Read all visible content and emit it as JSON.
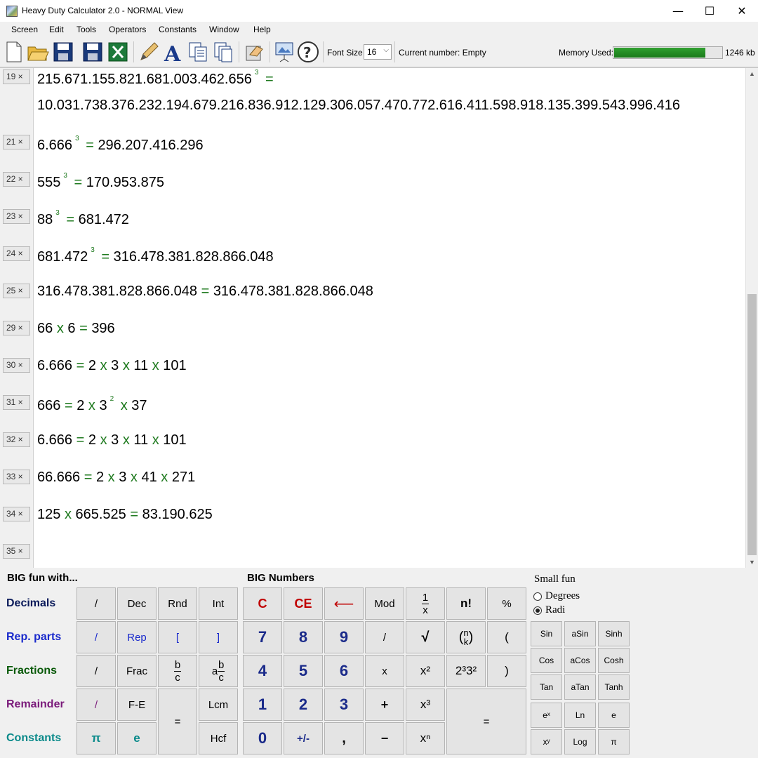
{
  "window": {
    "title": "Heavy Duty Calculator 2.0 - NORMAL View",
    "minimize": "—",
    "maximize": "☐",
    "close": "✕"
  },
  "menu": [
    "Screen",
    "Edit",
    "Tools",
    "Operators",
    "Constants",
    "Window",
    "Help"
  ],
  "toolbar": {
    "font_size_label": "Font Size",
    "font_size_value": "16",
    "current_number": "Current number: Empty",
    "memory_label": "Memory Used:",
    "memory_value": "1246 kb",
    "memory_fraction": 0.85,
    "accent_green": "#1a8a1a"
  },
  "lines": [
    {
      "num": "19 ×",
      "text": "215.671.155.821.681.003.462.656",
      "exp": "3",
      "result": "10.031.738.376.232.194.679.216.836.912.129.306.057.470.772.616.411.598.918.135.399.543.996.416"
    },
    {
      "num": "21 ×",
      "base": "6.666",
      "exp": "3",
      "result": "296.207.416.296"
    },
    {
      "num": "22 ×",
      "base": "555",
      "exp": "3",
      "result": "170.953.875"
    },
    {
      "num": "23 ×",
      "base": "88",
      "exp": "3",
      "result": "681.472"
    },
    {
      "num": "24 ×",
      "base": "681.472",
      "exp": "3",
      "result": "316.478.381.828.866.048"
    },
    {
      "num": "25 ×",
      "base": "316.478.381.828.866.048",
      "result": "316.478.381.828.866.048"
    },
    {
      "num": "29 ×",
      "a": "66",
      "b": "6",
      "result": "396"
    },
    {
      "num": "30 ×",
      "base": "6.666",
      "factors": [
        "2",
        "3",
        "11",
        "101"
      ]
    },
    {
      "num": "31 ×",
      "base": "666",
      "f1": "2",
      "f2": "3",
      "f2exp": "2",
      "f3": "37"
    },
    {
      "num": "32 ×",
      "base": "6.666",
      "factors": [
        "2",
        "3",
        "11",
        "101"
      ]
    },
    {
      "num": "33 ×",
      "base": "66.666",
      "factors": [
        "2",
        "3",
        "41",
        "271"
      ]
    },
    {
      "num": "34 ×",
      "a": "125",
      "b": "665.525",
      "result": "83.190.625"
    },
    {
      "num": "35 ×"
    }
  ],
  "ops": {
    "eq": "=",
    "times": "x"
  },
  "panel": {
    "big_fun_title": "BIG fun with...",
    "big_numbers_title": "BIG Numbers",
    "small_fun_title": "Small fun",
    "rows": {
      "decimals": "Decimals",
      "rep_parts": "Rep. parts",
      "fractions": "Fractions",
      "remainder": "Remainder",
      "constants": "Constants"
    },
    "colors": {
      "decimals": "#0a1a5a",
      "rep_parts": "#1a2acc",
      "fractions": "#0a5a0a",
      "remainder": "#7a1a7a",
      "constants": "#0a8a8a"
    },
    "left_buttons": {
      "dec_slash": "/",
      "dec": "Dec",
      "rnd": "Rnd",
      "int": "Int",
      "rep_slash": "/",
      "rep": "Rep",
      "lbr": "[",
      "rbr": "]",
      "frac_slash": "/",
      "frac": "Frac",
      "b": "b",
      "c": "c",
      "a": "a",
      "rem_slash": "/",
      "fe": "F-E",
      "lcm": "Lcm",
      "hcf": "Hcf",
      "eq": "=",
      "pi": "π",
      "e": "e"
    },
    "big_buttons": {
      "c": "C",
      "ce": "CE",
      "back": "⟵",
      "mod": "Mod",
      "one": "1",
      "x": "x",
      "fact": "n!",
      "pct": "%",
      "n7": "7",
      "n8": "8",
      "n9": "9",
      "div": "/",
      "sqrt": "√",
      "n": "n",
      "k": "k",
      "lpar": "(",
      "n4": "4",
      "n5": "5",
      "n6": "6",
      "mul": "x",
      "sq": "x²",
      "pf": "2³3²",
      "rpar": ")",
      "n1": "1",
      "n2": "2",
      "n3": "3",
      "plus": "+",
      "cube": "x³",
      "eq": "=",
      "n0": "0",
      "neg": "+/-",
      "comma": ",",
      "minus": "−",
      "pow": "xⁿ"
    },
    "small": {
      "degrees": "Degrees",
      "radians": "Radi",
      "sin": "Sin",
      "asin": "aSin",
      "sinh": "Sinh",
      "cos": "Cos",
      "acos": "aCos",
      "cosh": "Cosh",
      "tan": "Tan",
      "atan": "aTan",
      "tanh": "Tanh",
      "ex": "eˣ",
      "ln": "Ln",
      "e": "e",
      "xy": "xʸ",
      "log": "Log",
      "pi": "π"
    }
  }
}
